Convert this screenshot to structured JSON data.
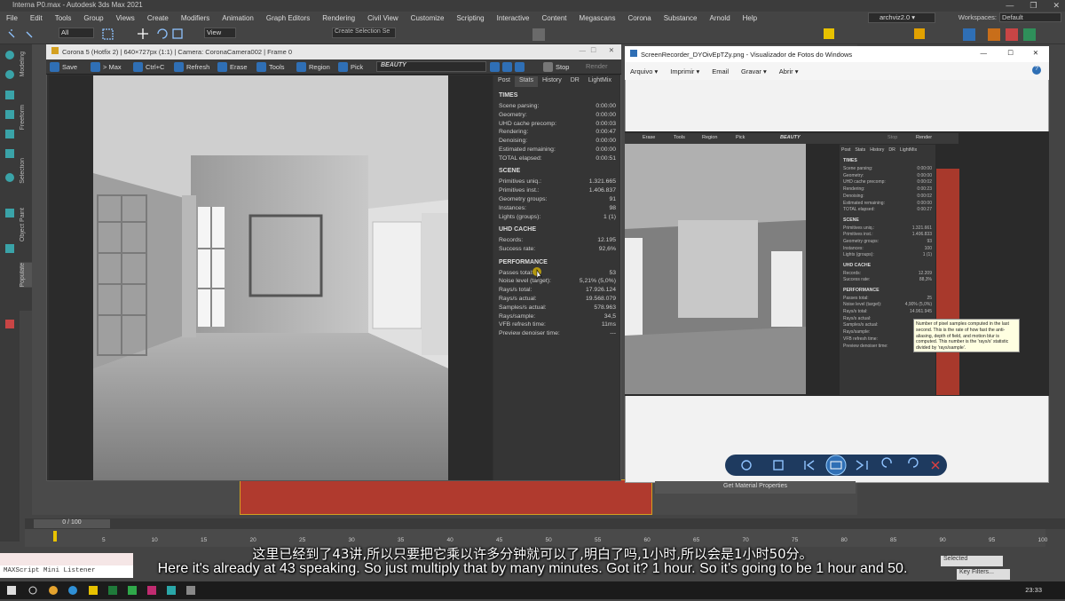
{
  "app": {
    "title": "Interna P0.max - Autodesk 3ds Max 2021",
    "menu": [
      "File",
      "Edit",
      "Tools",
      "Group",
      "Views",
      "Create",
      "Modifiers",
      "Animation",
      "Graph Editors",
      "Rendering",
      "Civil View",
      "Customize",
      "Scripting",
      "Interactive",
      "Content",
      "Megascans",
      "Corona",
      "Substance",
      "Arnold",
      "Help"
    ],
    "user": "archviz2.0",
    "workspace_label": "Workspaces:",
    "workspace_value": "Default",
    "selection_filter": "All",
    "ref_coord": "View",
    "create_selection_set": "Create Selection Se",
    "left_tabs": [
      "Modeling",
      "Freeform",
      "Selection",
      "Object Paint",
      "Populate"
    ]
  },
  "vfb": {
    "title": "Corona 5 (Hotfix 2) | 640×727px (1:1) | Camera: CoronaCamera002 | Frame 0",
    "toolbar": {
      "save": "Save",
      "max": "> Max",
      "copy": "Ctrl+C",
      "refresh": "Refresh",
      "erase": "Erase",
      "tools": "Tools",
      "region": "Region",
      "pick": "Pick",
      "stop": "Stop",
      "render": "Render"
    },
    "pass_dropdown": "BEAUTY",
    "tabs": [
      "Post",
      "Stats",
      "History",
      "DR",
      "LightMix"
    ],
    "active_tab": "Stats",
    "sections": {
      "times_title": "TIMES",
      "times": [
        {
          "label": "Scene parsing:",
          "value": "0:00:00"
        },
        {
          "label": "Geometry:",
          "value": "0:00:00"
        },
        {
          "label": "UHD cache precomp:",
          "value": "0:00:03"
        },
        {
          "label": "Rendering:",
          "value": "0:00:47"
        },
        {
          "label": "Denoising:",
          "value": "0:00:00"
        },
        {
          "label": "Estimated remaining:",
          "value": "0:00:00"
        },
        {
          "label": "TOTAL elapsed:",
          "value": "0:00:51"
        }
      ],
      "scene_title": "SCENE",
      "scene": [
        {
          "label": "Primitives uniq.:",
          "value": "1.321.665"
        },
        {
          "label": "Primitives inst.:",
          "value": "1.406.837"
        },
        {
          "label": "Geometry groups:",
          "value": "91"
        },
        {
          "label": "Instances:",
          "value": "98"
        },
        {
          "label": "Lights (groups):",
          "value": "1 (1)"
        }
      ],
      "uhd_title": "UHD CACHE",
      "uhd": [
        {
          "label": "Records:",
          "value": "12.195"
        },
        {
          "label": "Success rate:",
          "value": "92,6%"
        }
      ],
      "perf_title": "PERFORMANCE",
      "perf": [
        {
          "label": "Passes total:",
          "value": "53"
        },
        {
          "label": "Noise level (target):",
          "value": "5,21% (5,0%)"
        },
        {
          "label": "Rays/s total:",
          "value": "17.926.124"
        },
        {
          "label": "Rays/s actual:",
          "value": "19.568.079"
        },
        {
          "label": "Samples/s actual:",
          "value": "578.963"
        },
        {
          "label": "Rays/sample:",
          "value": "34,5"
        },
        {
          "label": "VFB refresh time:",
          "value": "11ms"
        },
        {
          "label": "Preview denoiser time:",
          "value": "---"
        }
      ]
    }
  },
  "viewer": {
    "title": "ScreenRecorder_DYOivEpTZy.png - Visualizador de Fotos do Windows",
    "menu": [
      "Arquivo",
      "Imprimir",
      "Email",
      "Gravar",
      "Abrir"
    ],
    "inner_toolbar": [
      "Erase",
      "Tools",
      "Region",
      "Pick",
      "BEAUTY",
      "Stop",
      "Render"
    ],
    "inner_tabs": [
      "Post",
      "Stats",
      "History",
      "DR",
      "LightMix"
    ],
    "inner_sections": {
      "times_title": "TIMES",
      "times": [
        {
          "label": "Scene parsing:",
          "value": "0:00:00"
        },
        {
          "label": "Geometry:",
          "value": "0:00:00"
        },
        {
          "label": "UHD cache precomp:",
          "value": "0:00:02"
        },
        {
          "label": "Rendering:",
          "value": "0:00:23"
        },
        {
          "label": "Denoising:",
          "value": "0:00:02"
        },
        {
          "label": "Estimated remaining:",
          "value": "0:00:00"
        },
        {
          "label": "TOTAL elapsed:",
          "value": "0:00:27"
        }
      ],
      "scene_title": "SCENE",
      "scene": [
        {
          "label": "Primitives uniq.:",
          "value": "1.321.661"
        },
        {
          "label": "Primitives inst.:",
          "value": "1.406.833"
        },
        {
          "label": "Geometry groups:",
          "value": "93"
        },
        {
          "label": "Instances:",
          "value": "100"
        },
        {
          "label": "Lights (groups):",
          "value": "1 (1)"
        }
      ],
      "uhd_title": "UHD CACHE",
      "uhd": [
        {
          "label": "Records:",
          "value": "12.209"
        },
        {
          "label": "Success rate:",
          "value": "88,3%"
        }
      ],
      "perf_title": "PERFORMANCE",
      "perf": [
        {
          "label": "Passes total:",
          "value": "25"
        },
        {
          "label": "Noise level (target):",
          "value": "4,90% (5,0%)"
        },
        {
          "label": "Rays/s total:",
          "value": "14.961.945"
        },
        {
          "label": "Rays/s actual:",
          "value": ""
        },
        {
          "label": "Samples/s actual:",
          "value": ""
        },
        {
          "label": "Rays/sample:",
          "value": ""
        },
        {
          "label": "VFB refresh time:",
          "value": ""
        },
        {
          "label": "Preview denoiser time:",
          "value": ""
        }
      ]
    },
    "tooltip": "Number of pixel samples computed in the last second. This is the rate of how fast the anti-aliasing, depth of field, and motion blur is computed. This number is the 'rays/s' statistic divided by 'rays/sample'."
  },
  "get_material": "Get Material Properties",
  "timeline": {
    "frame": "0 / 100",
    "ticks": [
      "5",
      "10",
      "15",
      "20",
      "25",
      "30",
      "35",
      "40",
      "45",
      "50",
      "55",
      "60",
      "65",
      "70",
      "75",
      "80",
      "85",
      "90",
      "95",
      "100"
    ]
  },
  "maxscript": "MAXScript Mini Listener",
  "selected": "Selected",
  "key_filters": "Key Filters...",
  "subtitle_zh": "这里已经到了43讲,所以只要把它乘以许多分钟就可以了,明白了吗,1小时,所以会是1小时50分。",
  "subtitle_en": "Here it's already at 43 speaking. So just multiply that by many minutes. Got it? 1 hour. So it's going to be 1 hour and 50.",
  "taskbar": {
    "clock": "23:33"
  },
  "colors": {
    "accent": "#2f6fb5",
    "red_panel": "#b03a2e",
    "tooltip_bg": "#ffffe1"
  }
}
